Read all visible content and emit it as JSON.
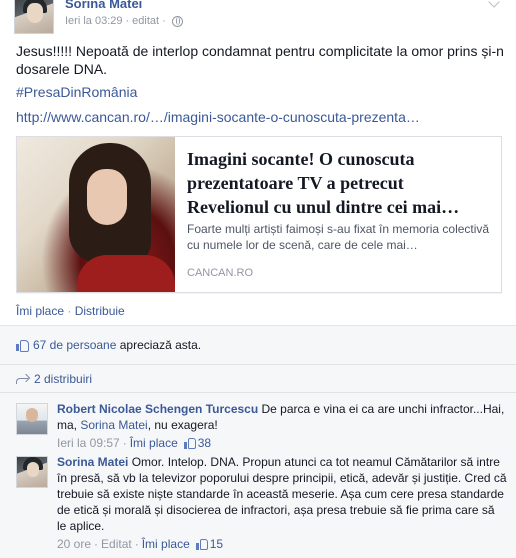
{
  "post": {
    "author": "Sorina Matei",
    "time": "Ieri la 03:29",
    "edited": "editat",
    "text": "Jesus!!!!! Nepoată de interlop condamnat pentru complicitate la omor prins și-n dosarele DNA.",
    "hashtag": "#PresaDinRomânia",
    "url": "http://www.cancan.ro/…/imagini-socante-o-cunoscuta-prezenta…",
    "privacy_icon": "globe-icon"
  },
  "link_card": {
    "title": "Imagini socante! O cunoscuta prezentatoare TV a petrecut Revelionul cu unul dintre cei mai…",
    "description": "Foarte mulți artiști faimoși s-au fixat în memoria colectivă cu numele lor de scenă, care de cele mai…",
    "domain": "CANCAN.RO"
  },
  "actions": {
    "like": "Îmi place",
    "separator": "·",
    "share": "Distribuie"
  },
  "ufi": {
    "likes_count": "67 de persoane",
    "likes_suffix": " apreciază asta.",
    "shares": "2 distribuiri"
  },
  "comments": [
    {
      "author": "Robert Nicolae Schengen Turcescu",
      "text_before": " De parca e vina ei ca are unchi infractor...Hai, ma, ",
      "mention": "Sorina Matei",
      "text_after": ", nu exagera!",
      "time": "Ieri la 09:57",
      "like_label": "Îmi place",
      "like_count": "38"
    },
    {
      "author": "Sorina Matei",
      "text": " Omor. Intelop. DNA. Propun atunci ca tot neamul Cămătarilor să intre în presă, să vb la televizor poporului despre principii, etică, adevăr și justiție. Cred că trebuie să existe niște standarde în această meserie. Așa cum cere presa standarde de etică și morală și disocierea de infractori, așa presa trebuie să fie prima care să le aplice.",
      "time": "20 ore",
      "edited": "Editat",
      "like_label": "Îmi place",
      "like_count": "15"
    }
  ],
  "colors": {
    "link": "#3b5998",
    "meta": "#9197a3",
    "ufi_bg": "#f6f7f8"
  }
}
